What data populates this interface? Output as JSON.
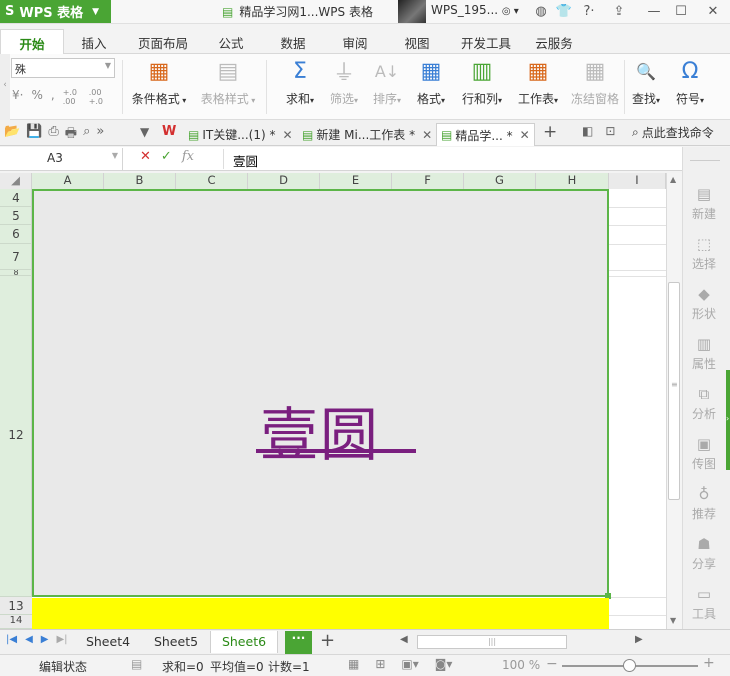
{
  "app": {
    "name": "WPS 表格",
    "logo": "S",
    "document_title": "精品学习网1...WPS 表格",
    "user": "WPS_195...",
    "brand_color": "#4aa534"
  },
  "ribbon_tabs": [
    "开始",
    "插入",
    "页面布局",
    "公式",
    "数据",
    "审阅",
    "视图",
    "开发工具",
    "云服务"
  ],
  "ribbon": {
    "font_value": "殊",
    "number_symbols": {
      "percent": "%",
      "inc_decimal": "+.0 .00",
      "dec_decimal": ".00 +.0"
    },
    "buttons": [
      {
        "label": "条件格式",
        "icon": "conditional-format-icon",
        "enabled": true
      },
      {
        "label": "表格样式",
        "icon": "table-style-icon",
        "enabled": false
      },
      {
        "label": "求和",
        "icon": "sigma-icon",
        "enabled": true
      },
      {
        "label": "筛选",
        "icon": "filter-icon",
        "enabled": false
      },
      {
        "label": "排序",
        "icon": "sort-icon",
        "enabled": false
      },
      {
        "label": "格式",
        "icon": "format-icon",
        "enabled": true
      },
      {
        "label": "行和列",
        "icon": "rows-cols-icon",
        "enabled": true
      },
      {
        "label": "工作表",
        "icon": "worksheet-icon",
        "enabled": true
      },
      {
        "label": "冻结窗格",
        "icon": "freeze-icon",
        "enabled": false
      },
      {
        "label": "查找",
        "icon": "find-icon",
        "enabled": true
      },
      {
        "label": "符号",
        "icon": "omega-icon",
        "enabled": true
      }
    ]
  },
  "doc_tabs": [
    {
      "label": "IT关键...(1) *",
      "active": false
    },
    {
      "label": "新建 Mi...工作表 *",
      "active": false
    },
    {
      "label": "精品学... *",
      "active": true
    }
  ],
  "find_command": "点此查找命令",
  "formula_bar": {
    "name_box": "A3",
    "fx": "fx",
    "value": "壹圆"
  },
  "columns": [
    "A",
    "B",
    "C",
    "D",
    "E",
    "F",
    "G",
    "H",
    "I"
  ],
  "rows": [
    "4",
    "5",
    "6",
    "7",
    "8",
    "12",
    "13",
    "14"
  ],
  "cell_text": "壹圆",
  "side_panel": [
    "新建",
    "选择",
    "形状",
    "属性",
    "分析",
    "传图",
    "推荐",
    "分享",
    "工具"
  ],
  "sheets": [
    "Sheet4",
    "Sheet5",
    "Sheet6"
  ],
  "active_sheet": "Sheet6",
  "status": {
    "mode": "编辑状态",
    "sum": "求和=0",
    "avg": "平均值=0",
    "count": "计数=1",
    "zoom": "100 %"
  }
}
